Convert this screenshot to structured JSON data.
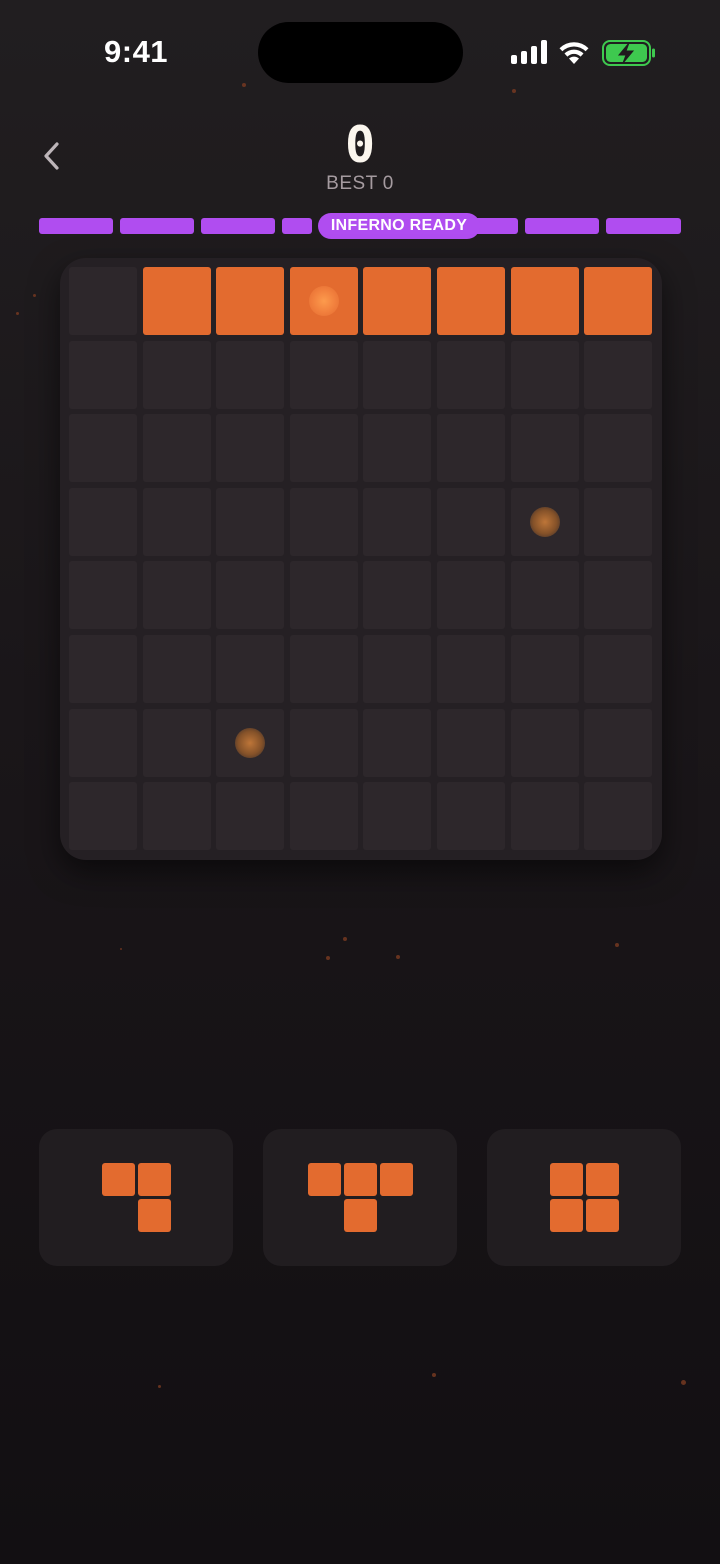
{
  "status_bar": {
    "time": "9:41"
  },
  "header": {
    "back_icon": "chevron-left-icon",
    "score": "0",
    "best_label": "BEST",
    "best_value": "0"
  },
  "progress": {
    "label": "INFERNO READY",
    "segments_total": 8,
    "color": "#b04df0"
  },
  "board": {
    "rows": 8,
    "cols": 8,
    "filled_color": "#e36b2f",
    "empty_color": "#2d272b",
    "grid": [
      [
        0,
        1,
        1,
        1,
        1,
        1,
        1,
        1
      ],
      [
        0,
        0,
        0,
        0,
        0,
        0,
        0,
        0
      ],
      [
        0,
        0,
        0,
        0,
        0,
        0,
        0,
        0
      ],
      [
        0,
        0,
        0,
        0,
        0,
        0,
        0,
        0
      ],
      [
        0,
        0,
        0,
        0,
        0,
        0,
        0,
        0
      ],
      [
        0,
        0,
        0,
        0,
        0,
        0,
        0,
        0
      ],
      [
        0,
        0,
        0,
        0,
        0,
        0,
        0,
        0
      ],
      [
        0,
        0,
        0,
        0,
        0,
        0,
        0,
        0
      ]
    ],
    "embers": [
      [
        0,
        3
      ],
      [
        3,
        6
      ],
      [
        6,
        2
      ]
    ]
  },
  "pieces": [
    {
      "name": "piece-1",
      "cells": [
        [
          0,
          0
        ],
        [
          0,
          1
        ],
        [
          1,
          1
        ]
      ]
    },
    {
      "name": "piece-2",
      "cells": [
        [
          0,
          0
        ],
        [
          0,
          1
        ],
        [
          0,
          2
        ],
        [
          1,
          1
        ]
      ]
    },
    {
      "name": "piece-3",
      "cells": [
        [
          0,
          0
        ],
        [
          0,
          1
        ],
        [
          1,
          0
        ],
        [
          1,
          1
        ]
      ]
    }
  ]
}
